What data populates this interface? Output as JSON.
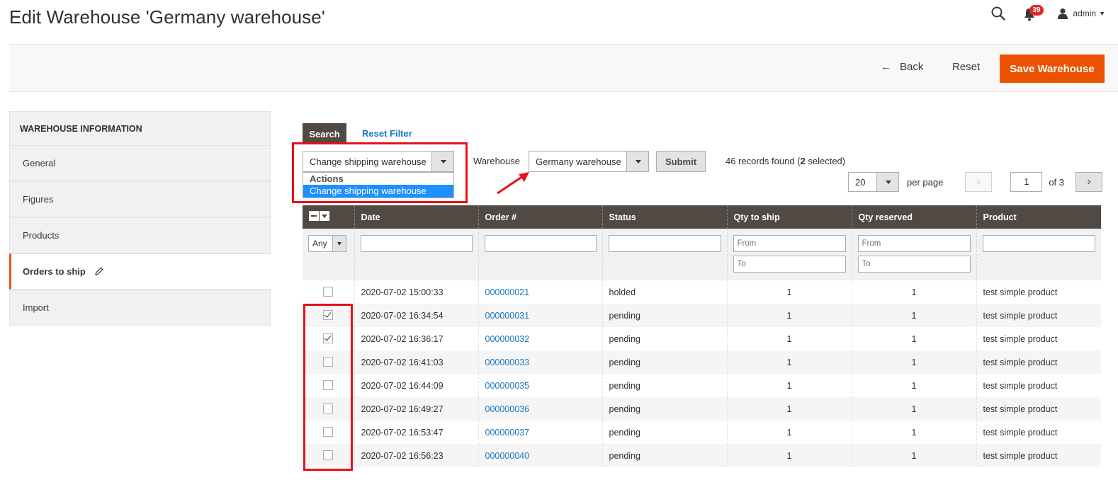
{
  "header": {
    "title": "Edit Warehouse 'Germany warehouse'",
    "notifications_count": "39",
    "user_name": "admin",
    "icons": [
      "search-icon",
      "bell-icon",
      "user-icon"
    ]
  },
  "page_actions": {
    "back_label": "Back",
    "reset_label": "Reset",
    "save_label": "Save Warehouse"
  },
  "sidebar": {
    "heading": "WAREHOUSE INFORMATION",
    "items": [
      {
        "label": "General"
      },
      {
        "label": "Figures"
      },
      {
        "label": "Products"
      },
      {
        "label": "Orders to ship"
      },
      {
        "label": "Import"
      }
    ],
    "active_index": 3
  },
  "grid_tools": {
    "search_label": "Search",
    "reset_filter_label": "Reset Filter",
    "massaction_value": "Change shipping warehouse",
    "massaction_group": "Actions",
    "massaction_option": "Change shipping warehouse",
    "warehouse_label": "Warehouse",
    "warehouse_value": "Germany warehouse",
    "submit_label": "Submit",
    "records_text_pre": "46 records found (",
    "records_selected": "2",
    "records_text_post": " selected)",
    "per_page_value": "20",
    "per_page_label": "per page",
    "page_current": "1",
    "page_of": "of 3"
  },
  "grid": {
    "columns": [
      "Date",
      "Order #",
      "Status",
      "Qty to ship",
      "Qty reserved",
      "Product"
    ],
    "filter_any": "Any",
    "from_placeholder": "From",
    "to_placeholder": "To",
    "rows": [
      {
        "checked": false,
        "date": "2020-07-02 15:00:33",
        "order": "000000021",
        "status": "holded",
        "qty_ship": "1",
        "qty_reserved": "1",
        "product": "test simple product"
      },
      {
        "checked": true,
        "date": "2020-07-02 16:34:54",
        "order": "000000031",
        "status": "pending",
        "qty_ship": "1",
        "qty_reserved": "1",
        "product": "test simple product"
      },
      {
        "checked": true,
        "date": "2020-07-02 16:36:17",
        "order": "000000032",
        "status": "pending",
        "qty_ship": "1",
        "qty_reserved": "1",
        "product": "test simple product"
      },
      {
        "checked": false,
        "date": "2020-07-02 16:41:03",
        "order": "000000033",
        "status": "pending",
        "qty_ship": "1",
        "qty_reserved": "1",
        "product": "test simple product"
      },
      {
        "checked": false,
        "date": "2020-07-02 16:44:09",
        "order": "000000035",
        "status": "pending",
        "qty_ship": "1",
        "qty_reserved": "1",
        "product": "test simple product"
      },
      {
        "checked": false,
        "date": "2020-07-02 16:49:27",
        "order": "000000036",
        "status": "pending",
        "qty_ship": "1",
        "qty_reserved": "1",
        "product": "test simple product"
      },
      {
        "checked": false,
        "date": "2020-07-02 16:53:47",
        "order": "000000037",
        "status": "pending",
        "qty_ship": "1",
        "qty_reserved": "1",
        "product": "test simple product"
      },
      {
        "checked": false,
        "date": "2020-07-02 16:56:23",
        "order": "000000040",
        "status": "pending",
        "qty_ship": "1",
        "qty_reserved": "1",
        "product": "test simple product"
      }
    ]
  },
  "colors": {
    "accent": "#eb5202",
    "header_bg": "#514943",
    "link": "#1979c3",
    "highlight": "#e8101a",
    "selected_option": "#1e90ff"
  }
}
